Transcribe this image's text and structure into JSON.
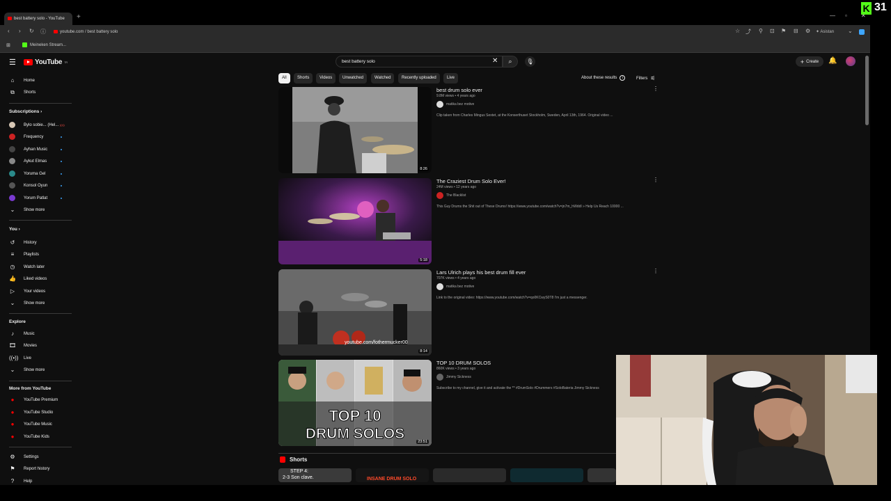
{
  "browser": {
    "tab_title": "best battery solo - YouTube",
    "new_tab": "+",
    "url": "youtube.com / best battery solo",
    "bookmark": "Meineken Stream...",
    "assistant": "Asistan",
    "kick_logo": "K",
    "kick_count": "31"
  },
  "masthead": {
    "logo": "YouTube",
    "logo_region": "TR",
    "search_value": "best battery solo",
    "create_label": "Create"
  },
  "sidebar": {
    "main": [
      {
        "label": "Home",
        "icon": "home-icon"
      },
      {
        "label": "Shorts",
        "icon": "shorts-icon"
      }
    ],
    "subscriptions_header": "Subscriptions",
    "subscriptions": [
      {
        "label": "Bylo sobie... (Hel...",
        "live": true
      },
      {
        "label": "Frequency"
      },
      {
        "label": "Ayhan Music"
      },
      {
        "label": "Aykut Elmas"
      },
      {
        "label": "Yoruma Gel"
      },
      {
        "label": "Konsol Oyun"
      },
      {
        "label": "Yorum Patlat"
      }
    ],
    "subs_show_more": "Show more",
    "you_header": "You",
    "you": [
      {
        "label": "History",
        "icon": "history-icon"
      },
      {
        "label": "Playlists",
        "icon": "playlists-icon"
      },
      {
        "label": "Watch later",
        "icon": "watch-later-icon"
      },
      {
        "label": "Liked videos",
        "icon": "like-icon"
      },
      {
        "label": "Your videos",
        "icon": "your-videos-icon"
      },
      {
        "label": "Show more",
        "icon": "chevron-down-icon"
      }
    ],
    "explore_header": "Explore",
    "explore": [
      {
        "label": "Music",
        "icon": "music-icon"
      },
      {
        "label": "Movies",
        "icon": "movies-icon"
      },
      {
        "label": "Live",
        "icon": "live-icon"
      },
      {
        "label": "Show more",
        "icon": "chevron-down-icon"
      }
    ],
    "more_header": "More from YouTube",
    "more": [
      {
        "label": "YouTube Premium"
      },
      {
        "label": "YouTube Studio"
      },
      {
        "label": "YouTube Music"
      },
      {
        "label": "YouTube Kids"
      }
    ],
    "bottom": [
      {
        "label": "Settings",
        "icon": "gear-icon"
      },
      {
        "label": "Report history",
        "icon": "flag-icon"
      },
      {
        "label": "Help",
        "icon": "help-icon"
      }
    ]
  },
  "chips": [
    "All",
    "Shorts",
    "Videos",
    "Unwatched",
    "Watched",
    "Recently uploaded",
    "Live"
  ],
  "about_results": "About these results",
  "filters": "Filters",
  "results": [
    {
      "title": "best drum solo ever",
      "meta": "9.8M views • 4 years ago",
      "channel": "matika bez motive",
      "desc": "Clip taken from Charles Mingus Sextet, at the Konserthuset Stockholm, Sweden, April 13th, 1964. Original video ...",
      "duration": "8:26"
    },
    {
      "title": "The Craziest Drum Solo Ever!",
      "meta": "24M views • 12 years ago",
      "channel": "The Blacklist",
      "desc": "This Guy Drums the Shit out of These Drums! https://www.youtube.com/watch?v=jn7m_hWddI » Help Us Reach 10000 ...",
      "duration": "5:18"
    },
    {
      "title": "Lars Ulrich plays his best drum fill ever",
      "meta": "707K views • 4 years ago",
      "channel": "matika bez motive",
      "desc": "Link to the original video: https://www.youtube.com/watch?v=qo0KCwyS0T8 I'm just a messenger.",
      "duration": "8:14"
    },
    {
      "title": "TOP 10 DRUM SOLOS",
      "meta": "860K views • 3 years ago",
      "channel": "Jimmy Sickness",
      "desc": "Subscribe to my channel, give it and activate the ** #DrumSolo #Drummers #SoloBateria Jimmy Sickness",
      "duration": "23:51"
    }
  ],
  "thumb_text": {
    "r3_watermark": "youtube.com/fothermucker00",
    "r4_line1": "TOP 10",
    "r4_line2": "DRUM SOLOS"
  },
  "shorts": {
    "header": "Shorts",
    "s1_text": "STEP 4:",
    "s1_text2": "2-3 Son clave.",
    "s2_text": "INSANE DRUM SOLO"
  }
}
